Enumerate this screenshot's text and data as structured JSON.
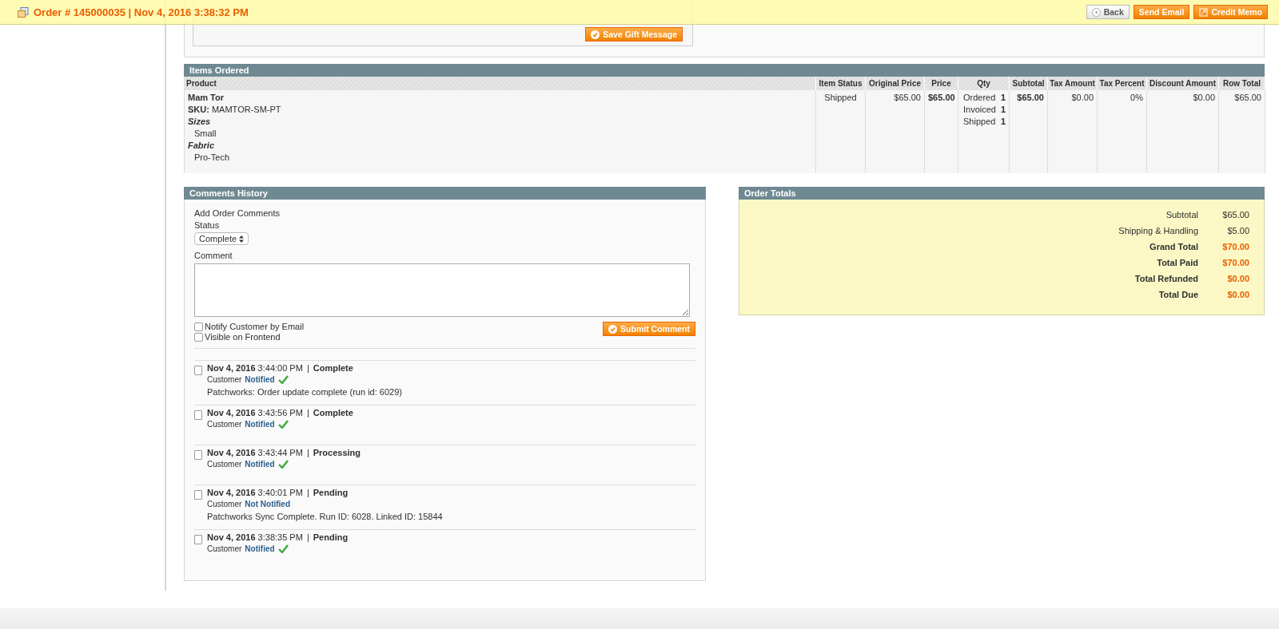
{
  "header": {
    "title": "Order # 145000035 | Nov 4, 2016 3:38:32 PM",
    "buttons": [
      {
        "label": "Back",
        "kind": "back"
      },
      {
        "label": "Send Email",
        "kind": "plain"
      },
      {
        "label": "Credit Memo",
        "kind": "memo"
      }
    ]
  },
  "gift_message": {
    "button": "Save Gift Message"
  },
  "items_ordered": {
    "title": "Items Ordered",
    "columns": [
      "Product",
      "Item Status",
      "Original Price",
      "Price",
      "Qty",
      "Subtotal",
      "Tax Amount",
      "Tax Percent",
      "Discount Amount",
      "Row Total"
    ],
    "rows": [
      {
        "name": "Mam Tor",
        "sku_label": "SKU:",
        "sku": "MAMTOR-SM-PT",
        "options": [
          {
            "label": "Sizes",
            "value": "Small"
          },
          {
            "label": "Fabric",
            "value": "Pro-Tech"
          }
        ],
        "item_status": "Shipped",
        "original_price": "$65.00",
        "price": "$65.00",
        "qty": [
          {
            "label": "Ordered",
            "value": "1"
          },
          {
            "label": "Invoiced",
            "value": "1"
          },
          {
            "label": "Shipped",
            "value": "1"
          }
        ],
        "subtotal": "$65.00",
        "tax_amount": "$0.00",
        "tax_percent": "0%",
        "discount_amount": "$0.00",
        "row_total": "$65.00"
      }
    ]
  },
  "comments_history": {
    "title": "Comments History",
    "add_label": "Add Order Comments",
    "status_label": "Status",
    "status_value": "Complete",
    "comment_label": "Comment",
    "checkboxes": [
      {
        "label": "Notify Customer by Email",
        "checked": false
      },
      {
        "label": "Visible on Frontend",
        "checked": false
      }
    ],
    "submit": "Submit Comment",
    "history": [
      {
        "date": "Nov 4, 2016",
        "time": "3:44:00 PM",
        "separator": "|",
        "status": "Complete",
        "customer": "Customer",
        "notified_text": "Notified",
        "notified": true,
        "note": "Patchworks: Order update complete (run id: 6029)"
      },
      {
        "date": "Nov 4, 2016",
        "time": "3:43:56 PM",
        "separator": "|",
        "status": "Complete",
        "customer": "Customer",
        "notified_text": "Notified",
        "notified": true
      },
      {
        "date": "Nov 4, 2016",
        "time": "3:43:44 PM",
        "separator": "|",
        "status": "Processing",
        "customer": "Customer",
        "notified_text": "Notified",
        "notified": true
      },
      {
        "date": "Nov 4, 2016",
        "time": "3:40:01 PM",
        "separator": "|",
        "status": "Pending",
        "customer": "Customer",
        "notified_text": "Not Notified",
        "notified": false,
        "note": "Patchworks Sync Complete. Run ID: 6028. Linked ID: 15844"
      },
      {
        "date": "Nov 4, 2016",
        "time": "3:38:35 PM",
        "separator": "|",
        "status": "Pending",
        "customer": "Customer",
        "notified_text": "Notified",
        "notified": true
      }
    ]
  },
  "order_totals": {
    "title": "Order Totals",
    "rows": [
      {
        "label": "Subtotal",
        "value": "$65.00",
        "strong": false
      },
      {
        "label": "Shipping & Handling",
        "value": "$5.00",
        "strong": false
      },
      {
        "label": "Grand Total",
        "value": "$70.00",
        "strong": true
      },
      {
        "label": "Total Paid",
        "value": "$70.00",
        "strong": true
      },
      {
        "label": "Total Refunded",
        "value": "$0.00",
        "strong": true
      },
      {
        "label": "Total Due",
        "value": "$0.00",
        "strong": true
      }
    ]
  }
}
